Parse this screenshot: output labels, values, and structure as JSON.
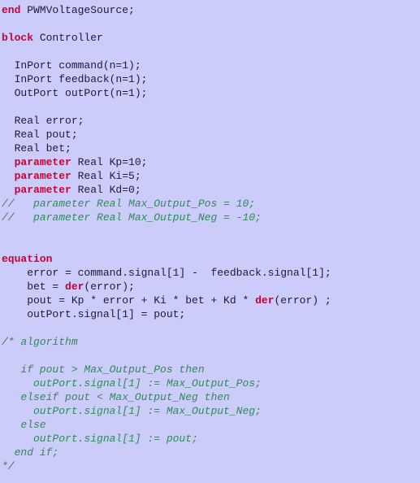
{
  "editor": {
    "language": "Modelica",
    "background_color": "#ccccfa",
    "plain_color": "#1a1a3c",
    "keyword_color": "#cc0033",
    "comment_color": "#2e8b57",
    "comment_mark_color": "#4f6b66"
  },
  "lines": [
    {
      "id": "line-1",
      "tokens": [
        {
          "text": "end",
          "type": "keyword"
        },
        {
          "text": " PWMVoltageSource;",
          "type": "plain"
        }
      ]
    },
    {
      "id": "line-2",
      "tokens": []
    },
    {
      "id": "line-3",
      "tokens": [
        {
          "text": "block",
          "type": "keyword"
        },
        {
          "text": " Controller",
          "type": "plain"
        }
      ]
    },
    {
      "id": "line-4",
      "tokens": []
    },
    {
      "id": "line-5",
      "tokens": [
        {
          "text": "  InPort command(n=1);",
          "type": "plain"
        }
      ]
    },
    {
      "id": "line-6",
      "tokens": [
        {
          "text": "  InPort feedback(n=1);",
          "type": "plain"
        }
      ]
    },
    {
      "id": "line-7",
      "tokens": [
        {
          "text": "  OutPort outPort(n=1);",
          "type": "plain"
        }
      ]
    },
    {
      "id": "line-8",
      "tokens": []
    },
    {
      "id": "line-9",
      "tokens": [
        {
          "text": "  Real error;",
          "type": "plain"
        }
      ]
    },
    {
      "id": "line-10",
      "tokens": [
        {
          "text": "  Real pout;",
          "type": "plain"
        }
      ]
    },
    {
      "id": "line-11",
      "tokens": [
        {
          "text": "  Real bet;",
          "type": "plain"
        }
      ]
    },
    {
      "id": "line-12",
      "tokens": [
        {
          "text": "  ",
          "type": "plain"
        },
        {
          "text": "parameter",
          "type": "keyword"
        },
        {
          "text": " Real Kp=10;",
          "type": "plain"
        }
      ]
    },
    {
      "id": "line-13",
      "tokens": [
        {
          "text": "  ",
          "type": "plain"
        },
        {
          "text": "parameter",
          "type": "keyword"
        },
        {
          "text": " Real Ki=5;",
          "type": "plain"
        }
      ]
    },
    {
      "id": "line-14",
      "tokens": [
        {
          "text": "  ",
          "type": "plain"
        },
        {
          "text": "parameter",
          "type": "keyword"
        },
        {
          "text": " Real Kd=0;",
          "type": "plain"
        }
      ]
    },
    {
      "id": "line-15",
      "tokens": [
        {
          "text": "//",
          "type": "comment-mark"
        },
        {
          "text": "   parameter Real Max_Output_Pos = 10;",
          "type": "comment"
        }
      ]
    },
    {
      "id": "line-16",
      "tokens": [
        {
          "text": "//",
          "type": "comment-mark"
        },
        {
          "text": "   parameter Real Max_Output_Neg = -10;",
          "type": "comment"
        }
      ]
    },
    {
      "id": "line-17",
      "tokens": []
    },
    {
      "id": "line-18",
      "tokens": []
    },
    {
      "id": "line-19",
      "tokens": [
        {
          "text": "equation",
          "type": "keyword"
        }
      ]
    },
    {
      "id": "line-20",
      "tokens": [
        {
          "text": "    error = command.signal[1] -  feedback.signal[1];",
          "type": "plain"
        }
      ]
    },
    {
      "id": "line-21",
      "tokens": [
        {
          "text": "    bet = ",
          "type": "plain"
        },
        {
          "text": "der",
          "type": "keyword"
        },
        {
          "text": "(error);",
          "type": "plain"
        }
      ]
    },
    {
      "id": "line-22",
      "tokens": [
        {
          "text": "    pout = Kp * error + Ki * bet + Kd * ",
          "type": "plain"
        },
        {
          "text": "der",
          "type": "keyword"
        },
        {
          "text": "(error) ;",
          "type": "plain"
        }
      ]
    },
    {
      "id": "line-23",
      "tokens": [
        {
          "text": "    outPort.signal[1] = pout;",
          "type": "plain"
        }
      ]
    },
    {
      "id": "line-24",
      "tokens": []
    },
    {
      "id": "line-25",
      "tokens": [
        {
          "text": "/*",
          "type": "comment-mark"
        },
        {
          "text": " algorithm",
          "type": "comment"
        }
      ]
    },
    {
      "id": "line-26",
      "tokens": []
    },
    {
      "id": "line-27",
      "tokens": [
        {
          "text": "   if pout > Max_Output_Pos then",
          "type": "comment"
        }
      ]
    },
    {
      "id": "line-28",
      "tokens": [
        {
          "text": "     outPort.signal[1] := Max_Output_Pos;",
          "type": "comment"
        }
      ]
    },
    {
      "id": "line-29",
      "tokens": [
        {
          "text": "   elseif pout < Max_Output_Neg then",
          "type": "comment"
        }
      ]
    },
    {
      "id": "line-30",
      "tokens": [
        {
          "text": "     outPort.signal[1] := Max_Output_Neg;",
          "type": "comment"
        }
      ]
    },
    {
      "id": "line-31",
      "tokens": [
        {
          "text": "   else",
          "type": "comment"
        }
      ]
    },
    {
      "id": "line-32",
      "tokens": [
        {
          "text": "     outPort.signal[1] := pout;",
          "type": "comment"
        }
      ]
    },
    {
      "id": "line-33",
      "tokens": [
        {
          "text": "  end if;",
          "type": "comment"
        }
      ]
    },
    {
      "id": "line-34",
      "tokens": [
        {
          "text": "*/",
          "type": "comment-mark"
        }
      ]
    }
  ]
}
